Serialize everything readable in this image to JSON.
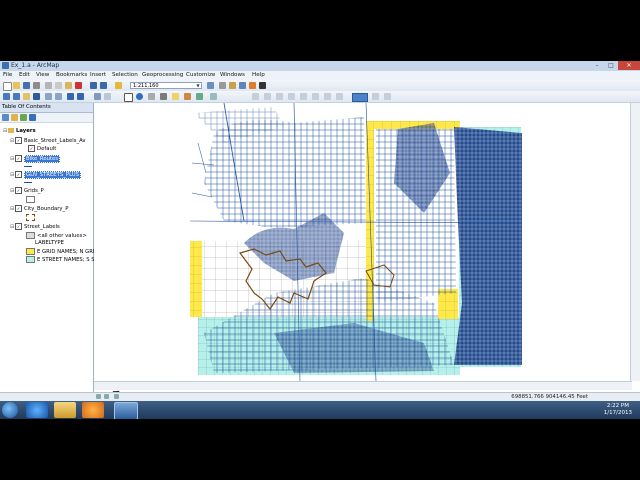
{
  "window": {
    "title": "Ex_1.a - ArcMap"
  },
  "menu": [
    "File",
    "Edit",
    "View",
    "Bookmarks",
    "Insert",
    "Selection",
    "Geoprocessing",
    "Customize",
    "Windows",
    "Help"
  ],
  "toolbar": {
    "scale": "1:211,160"
  },
  "toc": {
    "title": "Table Of Contents",
    "layers_label": "Layers",
    "layers": [
      {
        "name": "Basic_Street_Labels_Av",
        "checked": true,
        "sub": [
          "Default"
        ]
      },
      {
        "name": "Bike_Routes",
        "checked": true,
        "selected": true
      },
      {
        "name": "GLN_STREETS_PLUS",
        "checked": true,
        "selected": true
      },
      {
        "name": "Grids_P",
        "checked": true
      },
      {
        "name": "City_Boundary_P",
        "checked": true
      },
      {
        "name": "Street_Labels",
        "checked": true,
        "sub": [
          "<all other values>",
          "LABELTYPE",
          "E GRID NAMES; N GRID",
          "E STREET NAMES; S ST"
        ]
      }
    ]
  },
  "status": {
    "coords": "698851.766  904146.45 Feet"
  },
  "clock": {
    "time": "2:22 PM",
    "date": "1/17/2013"
  },
  "colors": {
    "streets": "#1e4e9c",
    "dense_streets": "#0b2f7a",
    "grid_yellow": "#ffe94a",
    "grid_cyan": "#b6f0ea",
    "boundary": "#7a4a12"
  },
  "icons": [
    "windows-start-icon",
    "ie-icon",
    "explorer-icon",
    "media-player-icon",
    "arcmap-icon"
  ]
}
